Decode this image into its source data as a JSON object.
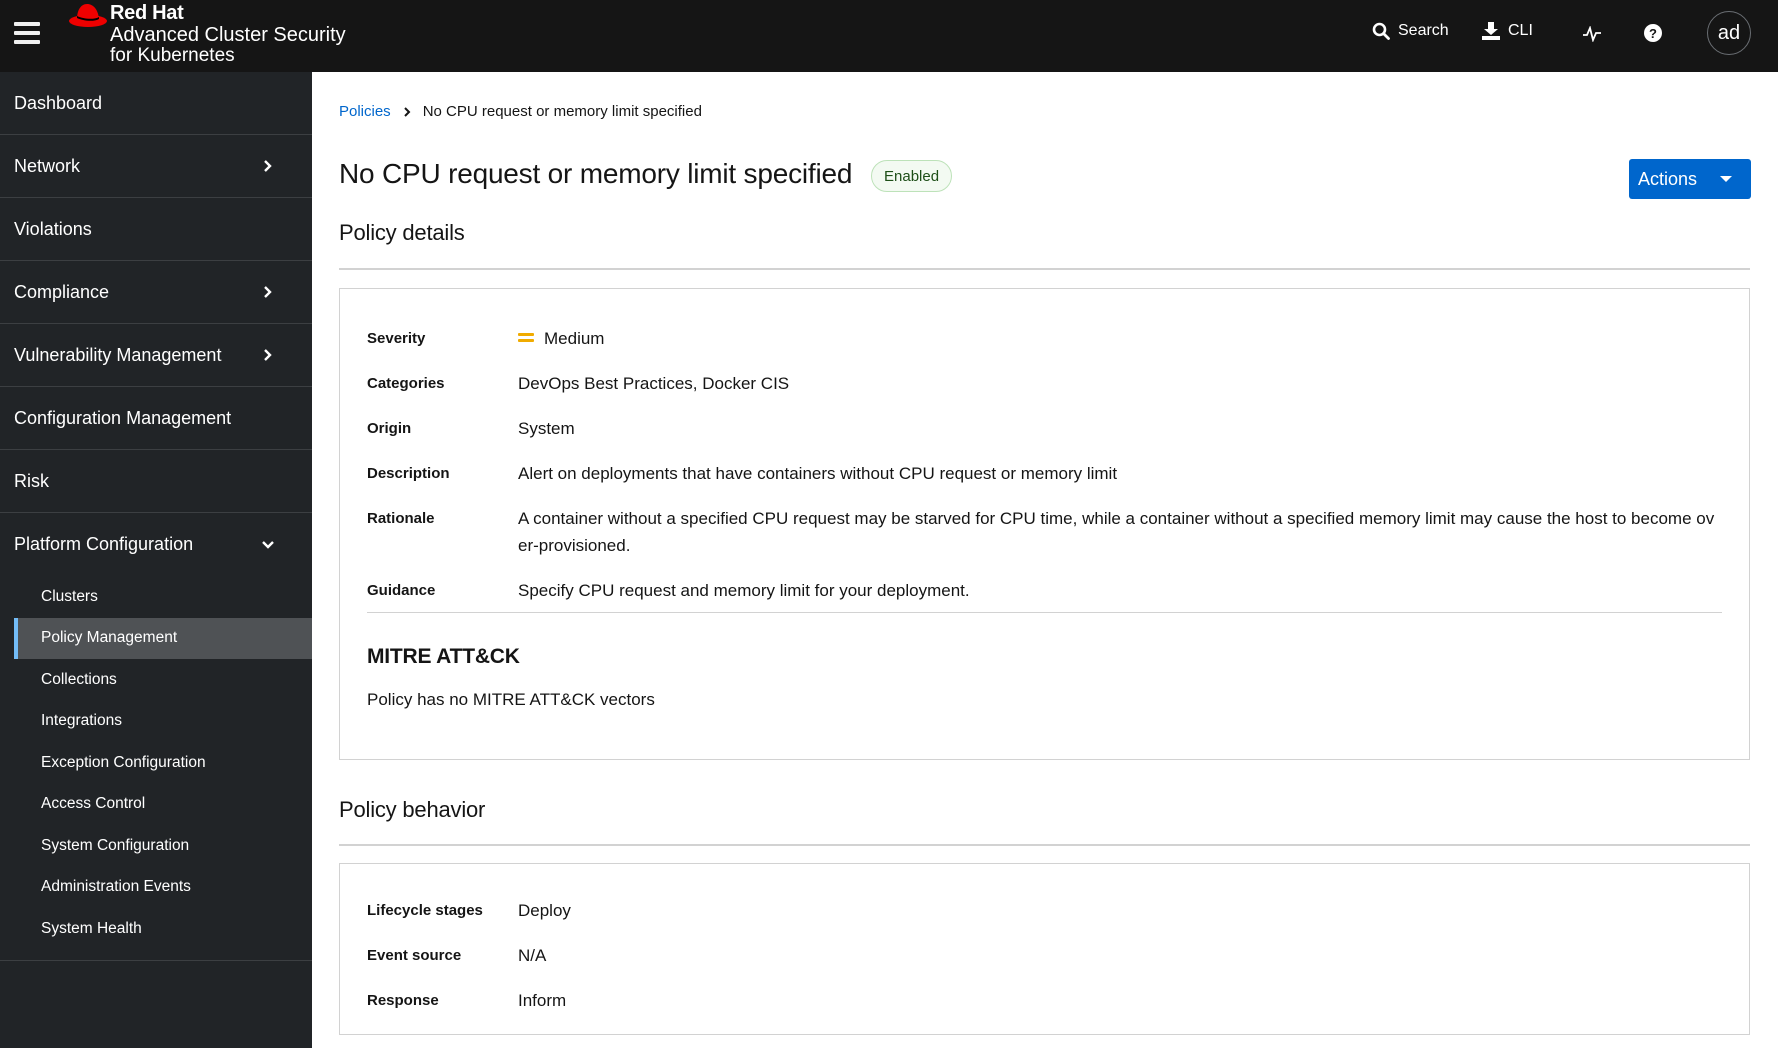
{
  "header": {
    "brand_line1": "Red Hat",
    "brand_line2": "Advanced Cluster Security",
    "brand_line3": "for Kubernetes",
    "search_label": "Search",
    "cli_label": "CLI",
    "avatar_initials": "ad",
    "icons": {
      "menu": "hamburger-icon",
      "logo": "red-hat-fedora-icon",
      "search": "search-icon",
      "cli": "download-icon",
      "health": "pulse-icon",
      "help": "question-circle-icon"
    }
  },
  "sidebar": {
    "items": [
      {
        "label": "Dashboard",
        "expandable": false
      },
      {
        "label": "Network",
        "expandable": true
      },
      {
        "label": "Violations",
        "expandable": false
      },
      {
        "label": "Compliance",
        "expandable": true
      },
      {
        "label": "Vulnerability Management",
        "expandable": true
      },
      {
        "label": "Configuration Management",
        "expandable": false
      },
      {
        "label": "Risk",
        "expandable": false
      }
    ],
    "group": {
      "label": "Platform Configuration",
      "expanded": true,
      "children": [
        {
          "label": "Clusters",
          "active": false
        },
        {
          "label": "Policy Management",
          "active": true
        },
        {
          "label": "Collections",
          "active": false
        },
        {
          "label": "Integrations",
          "active": false
        },
        {
          "label": "Exception Configuration",
          "active": false
        },
        {
          "label": "Access Control",
          "active": false
        },
        {
          "label": "System Configuration",
          "active": false
        },
        {
          "label": "Administration Events",
          "active": false
        },
        {
          "label": "System Health",
          "active": false
        }
      ]
    }
  },
  "breadcrumb": {
    "parent": "Policies",
    "current": "No CPU request or memory limit specified"
  },
  "page": {
    "title": "No CPU request or memory limit specified",
    "status_badge": "Enabled",
    "actions_label": "Actions"
  },
  "policy_details": {
    "heading": "Policy details",
    "fields": [
      {
        "label": "Severity",
        "value": "Medium",
        "icon": "severity-medium-icon",
        "color": "#f0ab00"
      },
      {
        "label": "Categories",
        "value": "DevOps Best Practices, Docker CIS"
      },
      {
        "label": "Origin",
        "value": "System"
      },
      {
        "label": "Description",
        "value": "Alert on deployments that have containers without CPU request or memory limit"
      },
      {
        "label": "Rationale",
        "value": "A container without a specified CPU request may be starved for CPU time, while a container without a specified memory limit may cause the host to become over-provisioned."
      },
      {
        "label": "Guidance",
        "value": "Specify CPU request and memory limit for your deployment."
      }
    ],
    "mitre_heading": "MITRE ATT&CK",
    "mitre_text": "Policy has no MITRE ATT&CK vectors"
  },
  "policy_behavior": {
    "heading": "Policy behavior",
    "fields": [
      {
        "label": "Lifecycle stages",
        "value": "Deploy"
      },
      {
        "label": "Event source",
        "value": "N/A"
      },
      {
        "label": "Response",
        "value": "Inform"
      }
    ]
  },
  "colors": {
    "primary": "#0066cc",
    "header_bg": "#151515",
    "sidebar_bg": "#212427",
    "active_item_bg": "#4f5255",
    "active_indicator": "#73bcf7",
    "brand_red": "#ee0000",
    "severity_medium": "#f0ab00"
  }
}
